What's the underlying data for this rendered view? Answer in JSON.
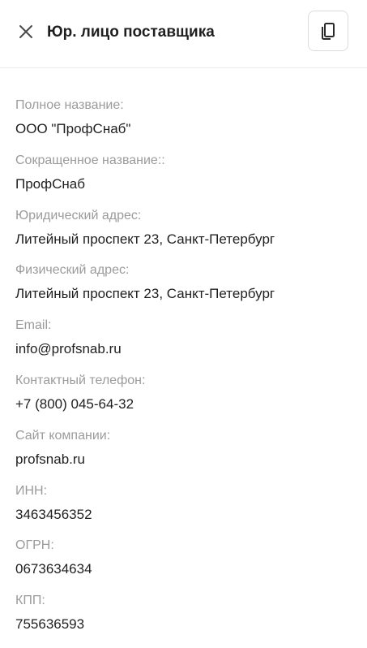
{
  "header": {
    "title": "Юр. лицо поставщика",
    "close_icon": "close-icon",
    "copy_icon": "copy-icon"
  },
  "fields": [
    {
      "label": "Полное название:",
      "value": "ООО \"ПрофСнаб\""
    },
    {
      "label": "Сокращенное название::",
      "value": "ПрофСнаб"
    },
    {
      "label": "Юридический адрес:",
      "value": "Литейный проспект 23, Санкт-Петербург"
    },
    {
      "label": "Физический адрес:",
      "value": "Литейный проспект 23, Санкт-Петербург"
    },
    {
      "label": "Email:",
      "value": "info@profsnab.ru"
    },
    {
      "label": "Контактный телефон:",
      "value": "+7 (800) 045-64-32"
    },
    {
      "label": "Сайт компании:",
      "value": "profsnab.ru"
    },
    {
      "label": "ИНН:",
      "value": "3463456352"
    },
    {
      "label": "ОГРН:",
      "value": "0673634634"
    },
    {
      "label": "КПП:",
      "value": "755636593"
    }
  ],
  "colors": {
    "label": "#9b9b9b",
    "value": "#1f1f1f",
    "border": "#dcdcdc"
  }
}
